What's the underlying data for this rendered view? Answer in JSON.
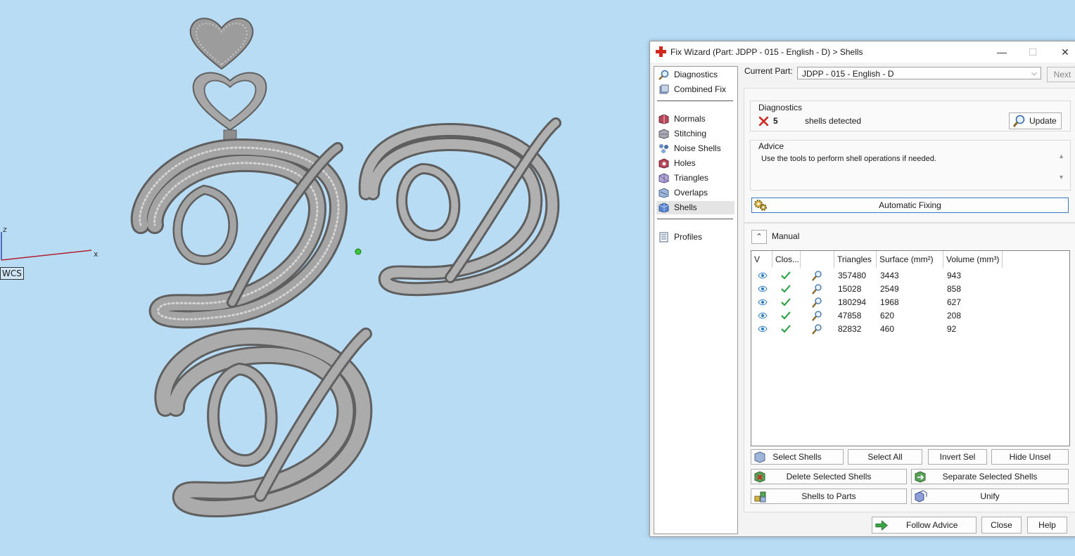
{
  "viewport": {
    "axis_z": "z",
    "axis_x": "x",
    "wcs_label": "WCS"
  },
  "window": {
    "title": "Fix Wizard (Part: JDPP - 015 - English - D) > Shells",
    "minimize": "—",
    "maximize": "☐",
    "close": "✕"
  },
  "nav": {
    "items": [
      {
        "label": "Diagnostics",
        "icon": "magnifier-icon"
      },
      {
        "label": "Combined Fix",
        "icon": "combined-fix-icon"
      },
      {
        "label": "Normals",
        "icon": "normals-icon"
      },
      {
        "label": "Stitching",
        "icon": "stitching-icon"
      },
      {
        "label": "Noise Shells",
        "icon": "noise-shells-icon"
      },
      {
        "label": "Holes",
        "icon": "holes-icon"
      },
      {
        "label": "Triangles",
        "icon": "triangles-icon"
      },
      {
        "label": "Overlaps",
        "icon": "overlaps-icon"
      },
      {
        "label": "Shells",
        "icon": "shells-icon"
      },
      {
        "label": "Profiles",
        "icon": "profiles-icon"
      }
    ],
    "active": "Shells"
  },
  "current_part": {
    "label": "Current Part:",
    "value": "JDPP - 015 - English - D",
    "next_label": "Next"
  },
  "diagnostics": {
    "title": "Diagnostics",
    "count": "5",
    "text": "shells detected",
    "update_label": "Update"
  },
  "advice": {
    "title": "Advice",
    "text": "Use the tools to perform shell operations if needed."
  },
  "automatic_fixing_label": "Automatic Fixing",
  "manual": {
    "title": "Manual",
    "columns": [
      "V",
      "Clos...",
      "",
      "Triangles",
      "Surface (mm²)",
      "Volume (mm³)"
    ],
    "rows": [
      {
        "triangles": "357480",
        "surface": "3443",
        "volume": "943"
      },
      {
        "triangles": "15028",
        "surface": "2549",
        "volume": "858"
      },
      {
        "triangles": "180294",
        "surface": "1968",
        "volume": "627"
      },
      {
        "triangles": "47858",
        "surface": "620",
        "volume": "208"
      },
      {
        "triangles": "82832",
        "surface": "460",
        "volume": "92"
      }
    ],
    "buttons": {
      "select_shells": "Select Shells",
      "select_all": "Select All",
      "invert_sel": "Invert Sel",
      "hide_unsel": "Hide Unsel",
      "delete_selected": "Delete Selected Shells",
      "separate_selected": "Separate Selected Shells",
      "shells_to_parts": "Shells to Parts",
      "unify": "Unify"
    }
  },
  "footer": {
    "follow_advice": "Follow Advice",
    "close": "Close",
    "help": "Help"
  },
  "colors": {
    "viewport_bg": "#b9dcf5",
    "model_fill": "#a9a9a9",
    "error_red": "#d0281e",
    "check_green": "#1f9e3a",
    "eye_blue": "#2d7fc4"
  }
}
